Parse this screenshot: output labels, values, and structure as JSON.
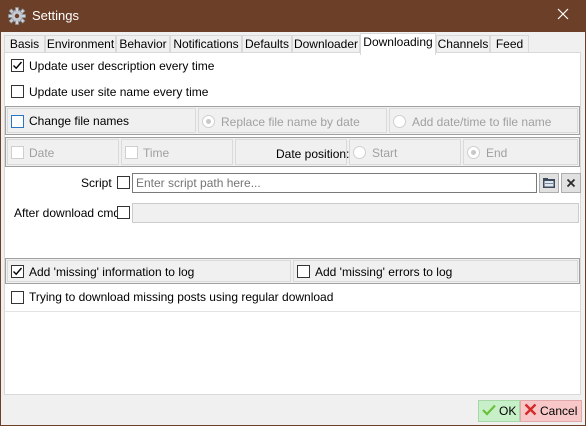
{
  "window": {
    "title": "Settings",
    "close_glyph": "✕"
  },
  "tabs": [
    {
      "label": "Basis",
      "active": false
    },
    {
      "label": "Environment",
      "active": false
    },
    {
      "label": "Behavior",
      "active": false
    },
    {
      "label": "Notifications",
      "active": false
    },
    {
      "label": "Defaults",
      "active": false
    },
    {
      "label": "Downloader",
      "active": false
    },
    {
      "label": "Downloading",
      "active": true
    },
    {
      "label": "Channels",
      "active": false
    },
    {
      "label": "Feed",
      "active": false
    }
  ],
  "options": {
    "update_description": {
      "label": "Update user description every time",
      "checked": true
    },
    "update_site_name": {
      "label": "Update user site name every time",
      "checked": false
    },
    "change_file_names": {
      "label": "Change file names",
      "checked": false
    },
    "replace_by_date": {
      "label": "Replace file name by date",
      "selected": true
    },
    "add_date_time": {
      "label": "Add date/time to file name",
      "selected": false
    },
    "date": {
      "label": "Date",
      "checked": false
    },
    "time": {
      "label": "Time",
      "checked": false
    },
    "date_position": {
      "label": "Date position:"
    },
    "start": {
      "label": "Start",
      "selected": false
    },
    "end": {
      "label": "End",
      "selected": true
    },
    "script": {
      "label": "Script",
      "checked": false,
      "placeholder": "Enter script path here..."
    },
    "after_download": {
      "label": "After download cmd",
      "checked": false
    },
    "missing_info": {
      "label": "Add 'missing' information to log",
      "checked": true
    },
    "missing_errors": {
      "label": "Add 'missing' errors to log",
      "checked": false
    },
    "regular_download": {
      "label": "Trying to download missing posts using regular download",
      "checked": false
    }
  },
  "footer": {
    "ok_label": "OK",
    "cancel_label": "Cancel"
  },
  "colors": {
    "titlebar": "#6b3f28",
    "ok_bg": "#c8f0c8",
    "cancel_bg": "#f8c8c8"
  },
  "icons": {
    "title": "gear-icon",
    "close": "close-icon",
    "open_folder": "folder-open-icon",
    "clear": "clear-icon",
    "ok": "checkmark-icon",
    "cancel": "cross-icon"
  }
}
